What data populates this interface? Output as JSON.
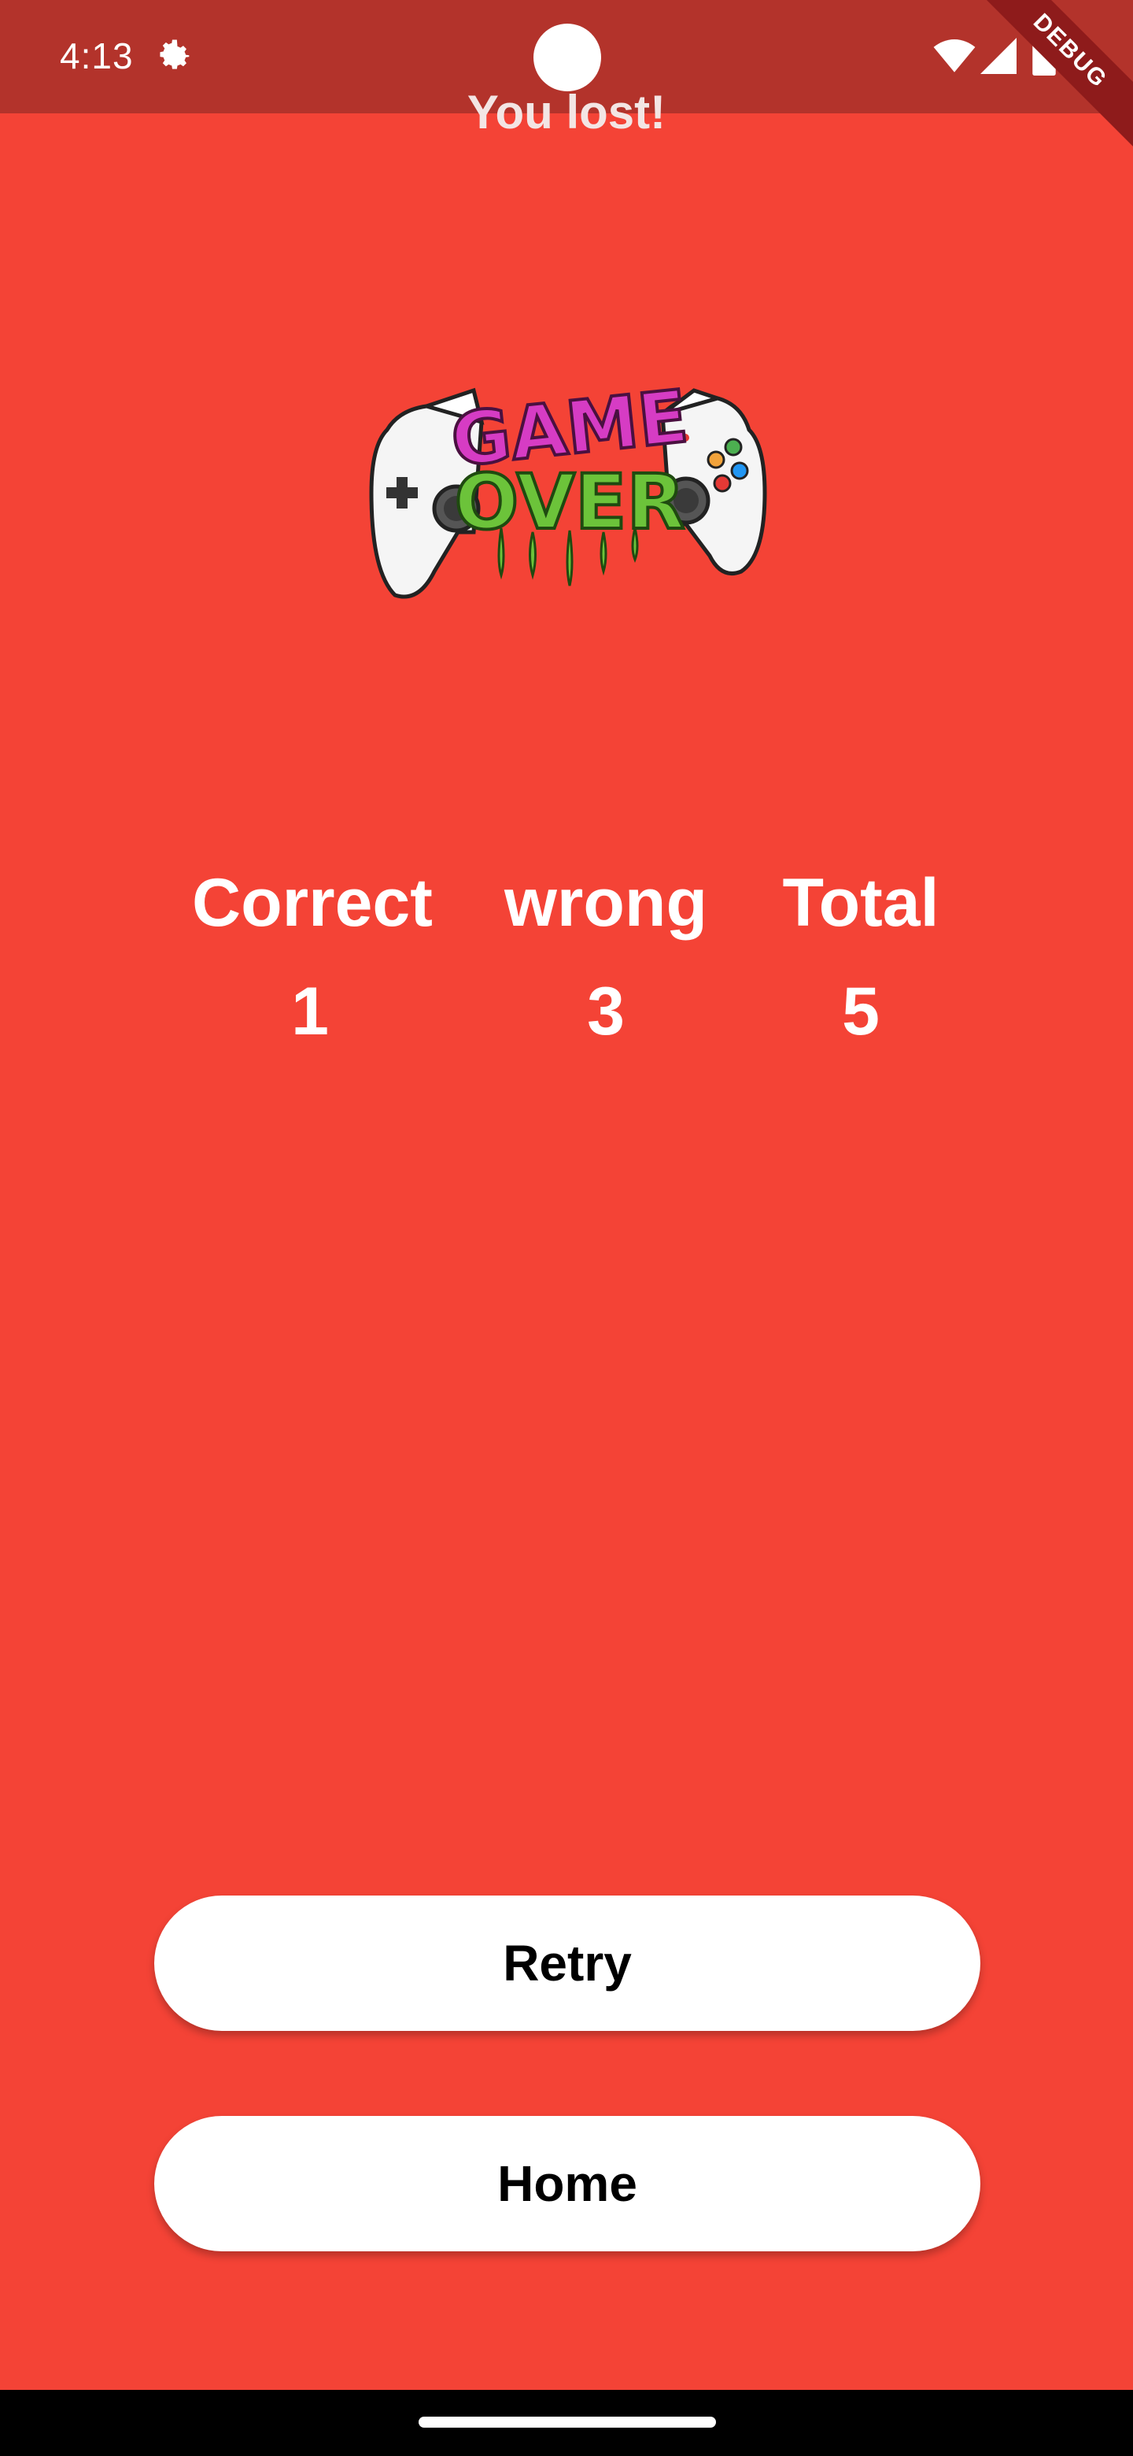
{
  "status_bar": {
    "time": "4:13",
    "icons": [
      "gear-icon",
      "wifi-icon",
      "signal-icon",
      "battery-icon"
    ],
    "debug_label": "DEBUG"
  },
  "screen": {
    "title": "You lost!",
    "background_color": "#f44336"
  },
  "logo": {
    "name": "game-over-controller-logo",
    "line1": "GAME",
    "line2": "OVER"
  },
  "stats": {
    "correct_label": "Correct",
    "correct_value": "1",
    "wrong_label": "wrong",
    "wrong_value": "3",
    "total_label": "Total",
    "total_value": "5"
  },
  "buttons": {
    "retry_label": "Retry",
    "home_label": "Home"
  }
}
